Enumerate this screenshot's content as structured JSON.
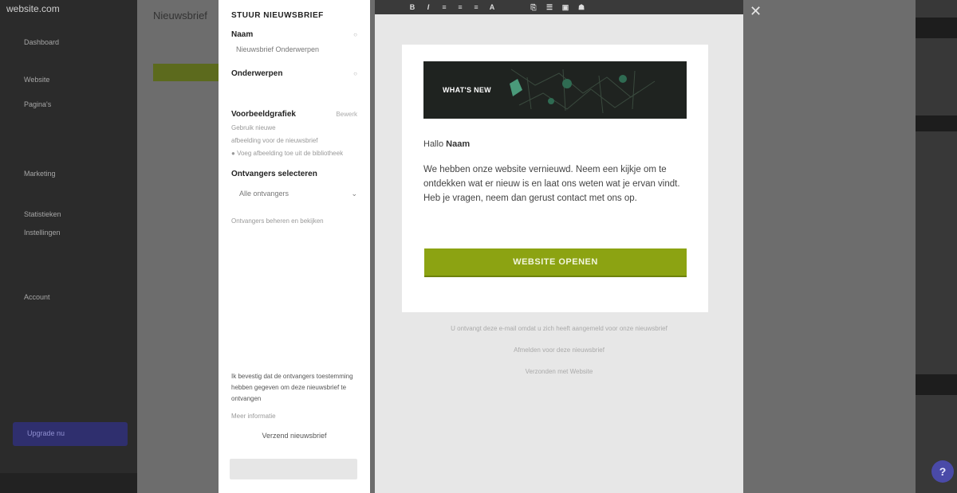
{
  "panel": {
    "title": "STUUR NIEUWSBRIEF",
    "name_label": "Naam",
    "name_value": "Nieuwsbrief Onderwerpen",
    "subject_label": "Onderwerpen",
    "preview_label": "Voorbeeldgrafiek",
    "preview_action": "Bewerk",
    "preview_lines": [
      "Gebruik nieuwe",
      "afbeelding voor de nieuwsbrief",
      "Voeg afbeelding toe uit de bibliotheek"
    ],
    "recipients_label": "Ontvangers selecteren",
    "recipients_value": "Alle ontvangers",
    "recipients_link": "Ontvangers beheren en bekijken",
    "confirm_text": "Ik bevestig dat de ontvangers toestemming hebben gegeven om deze nieuwsbrief te ontvangen",
    "confirm_link": "Meer informatie",
    "send_label": "Verzend nieuwsbrief"
  },
  "toolbar": {
    "bold": "B",
    "italic": "I",
    "align_left": "≡",
    "align_center": "≡",
    "align_right": "≡",
    "font": "A",
    "link": "⎘",
    "list": "☰",
    "image": "▣",
    "user": "☗"
  },
  "email": {
    "banner_text": "WHAT'S NEW",
    "greeting_prefix": "Hallo",
    "greeting_name": "Naam",
    "body": "We hebben onze website vernieuwd. Neem een kijkje om te ontdekken wat er nieuw is en laat ons weten wat je ervan vindt. Heb je vragen, neem dan gerust contact met ons op.",
    "cta_label": "WEBSITE OPENEN",
    "footer_lines": [
      "U ontvangt deze e-mail omdat u zich heeft aangemeld voor onze nieuwsbrief",
      "Afmelden voor deze nieuwsbrief",
      "Verzonden met Website"
    ]
  },
  "background": {
    "logo": "website.com",
    "title": "Nieuwsbrief",
    "nav": [
      "Dashboard",
      "Website",
      "Pagina's",
      "Marketing",
      "Statistieken",
      "Instellingen",
      "Account"
    ],
    "upgrade": "Upgrade nu"
  },
  "close_label": "✕",
  "help_label": "?"
}
